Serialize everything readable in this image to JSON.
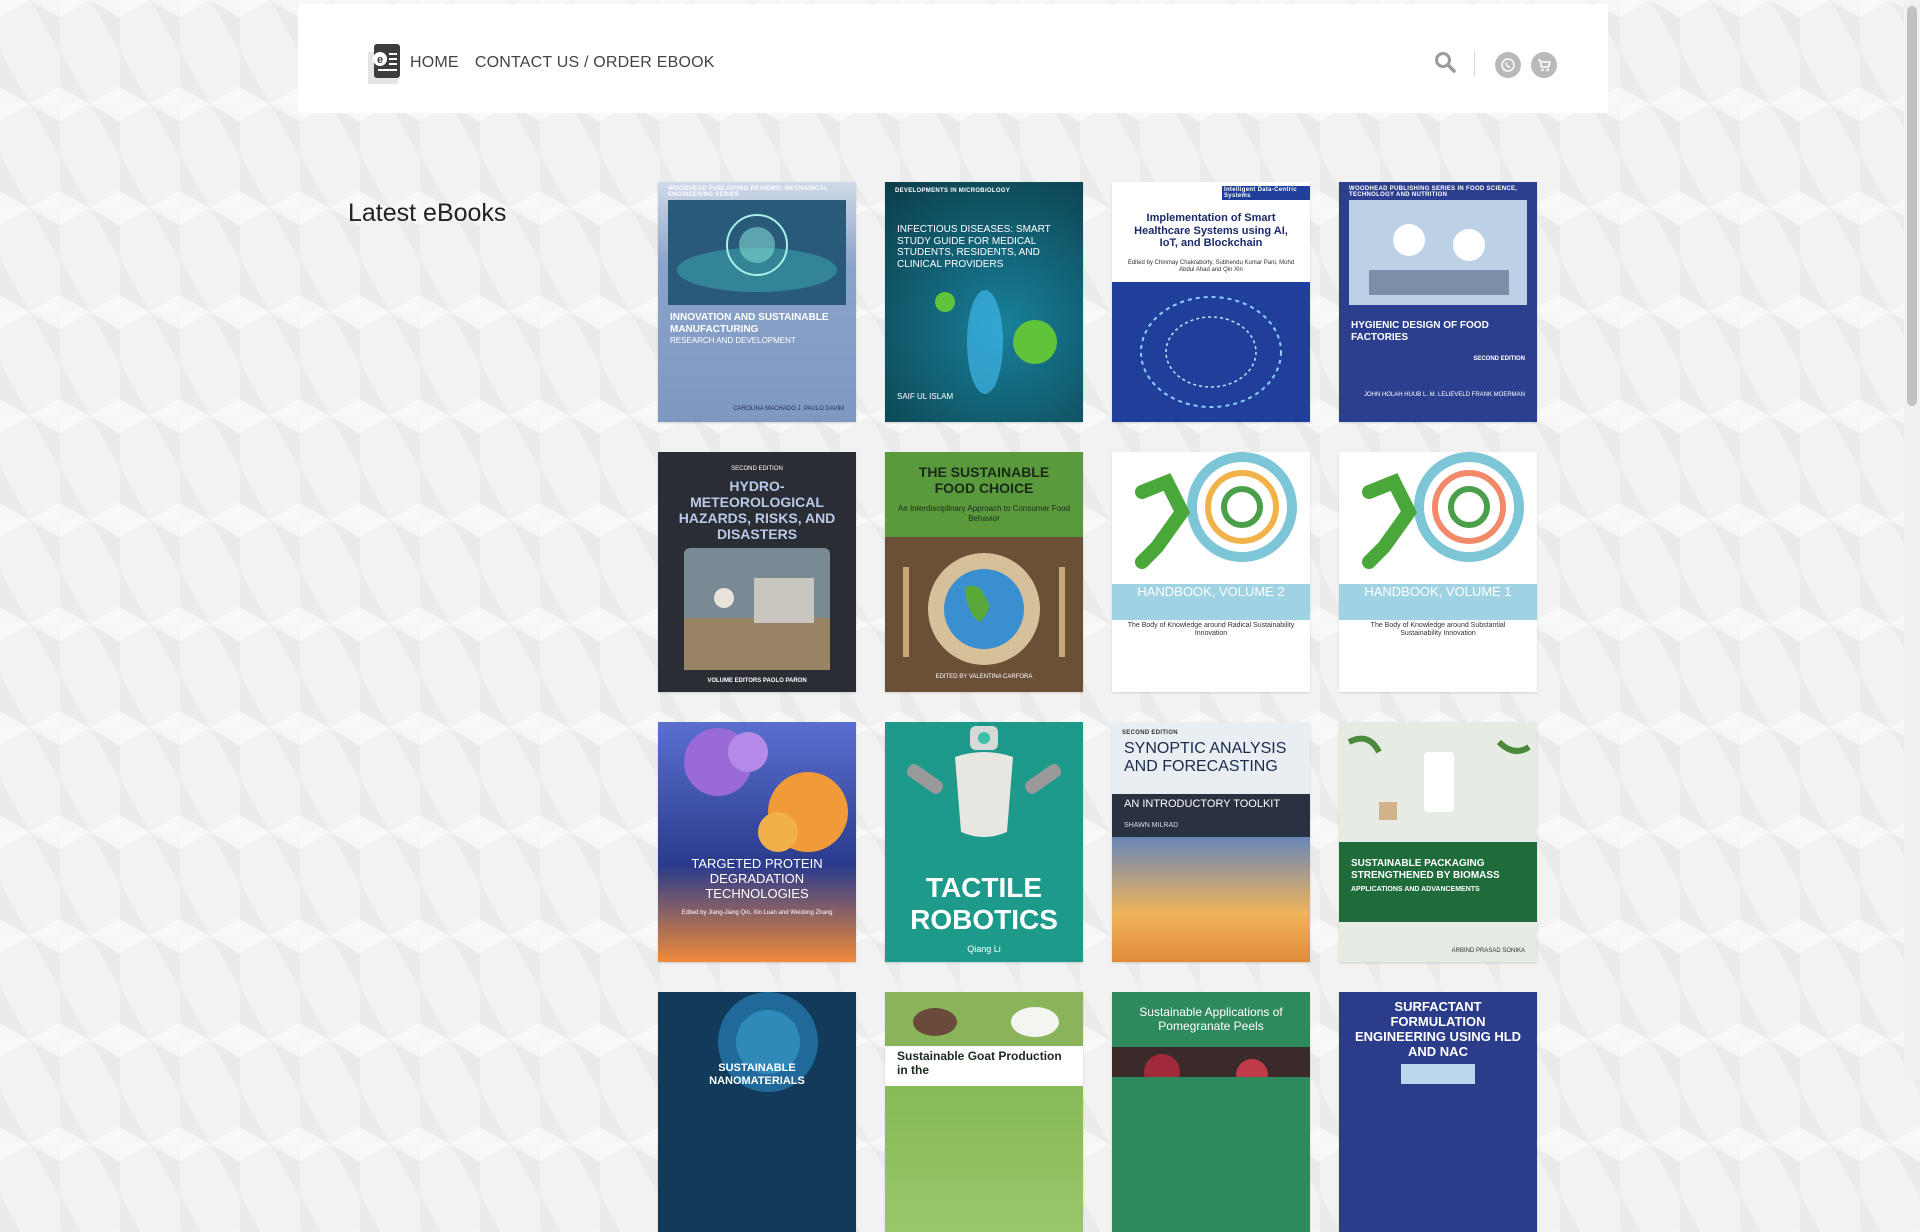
{
  "nav": {
    "home": "HOME",
    "contact": "CONTACT US / ORDER EBOOK"
  },
  "icons": {
    "logo": "ebook-logo-icon",
    "search": "search-icon",
    "whatsapp": "whatsapp-icon",
    "cart": "cart-icon"
  },
  "section": {
    "title": "Latest eBooks"
  },
  "books": [
    {
      "title": "INNOVATION AND SUSTAINABLE MANUFACTURING",
      "subtitle": "RESEARCH AND DEVELOPMENT",
      "series": "WOODHEAD PUBLISHING REVIEWS: MECHANICAL ENGINEERING SERIES",
      "editors": "CAROLINA MACHADO  J. PAULO DAVIM",
      "bg": "#8aa3c9"
    },
    {
      "title": "INFECTIOUS DISEASES: SMART STUDY GUIDE FOR MEDICAL STUDENTS, RESIDENTS, AND CLINICAL PROVIDERS",
      "subtitle": "SAIF UL ISLAM",
      "series": "DEVELOPMENTS IN MICROBIOLOGY",
      "editors": "",
      "bg": "#0e4e5c"
    },
    {
      "title": "Implementation of Smart Healthcare Systems using AI, IoT, and Blockchain",
      "subtitle": "Edited by Chinmay Chakraborty, Subhendu Kumar Pani, Mohd Abdul Ahad and Qin Xin",
      "series": "Intelligent Data-Centric Systems",
      "editors": "",
      "bg": "#1f3f9a"
    },
    {
      "title": "HYGIENIC DESIGN OF FOOD FACTORIES",
      "subtitle": "SECOND EDITION",
      "series": "WOODHEAD PUBLISHING SERIES IN FOOD SCIENCE, TECHNOLOGY AND NUTRITION",
      "editors": "JOHN HOLAH  HUUB L. M. LELIEVELD  FRANK MOERMAN",
      "bg": "#2c3f8f"
    },
    {
      "title": "HYDRO-METEOROLOGICAL HAZARDS, RISKS, AND DISASTERS",
      "subtitle": "SECOND EDITION",
      "series": "",
      "editors": "VOLUME EDITORS PAOLO PARON",
      "bg": "#2b2d35"
    },
    {
      "title": "THE SUSTAINABLE FOOD CHOICE",
      "subtitle": "An Interdisciplinary Approach to Consumer Food Behavior",
      "series": "",
      "editors": "EDITED BY VALENTINA CARFORA",
      "bg": "#5a9a3c"
    },
    {
      "title": "THE SUSTAINABILITY HANDBOOK, VOLUME 2",
      "subtitle": "The Body of Knowledge around Radical Sustainability Innovation",
      "series": "",
      "editors": "",
      "bg": "#9fd3e3"
    },
    {
      "title": "THE SUSTAINABILITY HANDBOOK, VOLUME 1",
      "subtitle": "The Body of Knowledge around Substantial Sustainability Innovation",
      "series": "",
      "editors": "",
      "bg": "#9fd3e3"
    },
    {
      "title": "TARGETED PROTEIN DEGRADATION TECHNOLOGIES",
      "subtitle": "Edited by Jiang-Jiang Qin, Xin Luan and Weidong Zhang",
      "series": "",
      "editors": "",
      "bg": "#2a3b8c"
    },
    {
      "title": "TACTILE ROBOTICS",
      "subtitle": "Qiang Li",
      "series": "",
      "editors": "",
      "bg": "#1d9a8a"
    },
    {
      "title": "SYNOPTIC ANALYSIS AND FORECASTING",
      "subtitle": "AN INTRODUCTORY TOOLKIT",
      "series": "SECOND EDITION",
      "editors": "SHAWN MILRAD",
      "bg": "#e9eef3"
    },
    {
      "title": "SUSTAINABLE PACKAGING STRENGTHENED BY BIOMASS",
      "subtitle": "APPLICATIONS AND ADVANCEMENTS",
      "series": "",
      "editors": "ARBIND PRASAD  SONIKA",
      "bg": "#1f6b3a"
    },
    {
      "title": "SUSTAINABLE NANOMATERIALS",
      "subtitle": "",
      "series": "",
      "editors": "",
      "bg": "#123a5a"
    },
    {
      "title": "Sustainable Goat Production in the",
      "subtitle": "",
      "series": "",
      "editors": "",
      "bg": "#7cb24a"
    },
    {
      "title": "Sustainable Applications of Pomegranate Peels",
      "subtitle": "",
      "series": "",
      "editors": "",
      "bg": "#2e8a5c"
    },
    {
      "title": "SURFACTANT FORMULATION ENGINEERING USING HLD AND NAC",
      "subtitle": "",
      "series": "",
      "editors": "",
      "bg": "#2b3c8a"
    }
  ]
}
